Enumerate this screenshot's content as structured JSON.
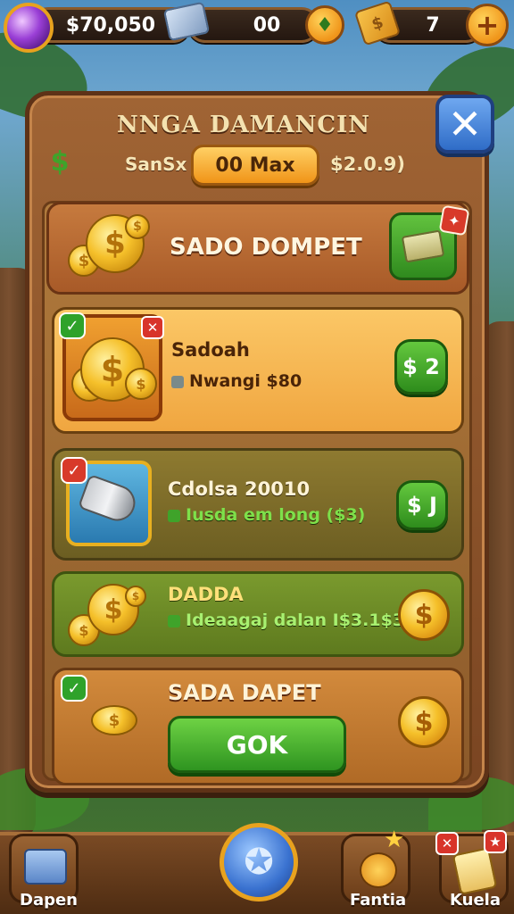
{
  "topbar": {
    "cash": "$70,050",
    "gems": "00",
    "tickets": "7",
    "plus": "+"
  },
  "panel": {
    "title": "NNGA DAMANCIN",
    "sub_left": "SanSx",
    "max_button": "00 Max",
    "sub_right": "$2.0.9)",
    "close_symbol": "✕"
  },
  "header_card": {
    "label": "SADO DOMPET"
  },
  "offers": [
    {
      "title": "Sadoah",
      "subtitle": "Nwangi $80",
      "price": "$ 2"
    },
    {
      "title": "Cdolsa 20010",
      "subtitle": "Iusda em long ($3)",
      "price": "$ J"
    },
    {
      "title": "DADDA",
      "subtitle": "Ideaagaj dalan I$3.1$3)",
      "price": "$"
    },
    {
      "title": "SADA DAPET",
      "button": "GOK",
      "price": "$"
    }
  ],
  "bottom_nav": {
    "left_label": "Dapen",
    "center_symbol": "✪",
    "right1_label": "Fantia",
    "right2_label": "Kuela"
  },
  "colors": {
    "panel_wood": "#8c5a2a",
    "green_button": "#2e8c1c",
    "gold": "#f5c02a",
    "blue_close": "#2f6cc7"
  }
}
